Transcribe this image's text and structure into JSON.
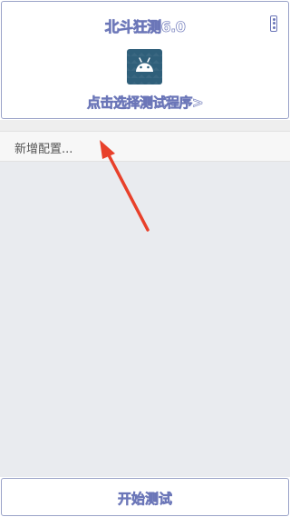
{
  "header": {
    "title": "北斗狂测6.0",
    "select_app_label": "点击选择测试程序>",
    "app_icon": "android-icon",
    "menu_icon": "more-vertical-icon"
  },
  "main": {
    "add_config_label": "新增配置..."
  },
  "footer": {
    "start_test_label": "开始测试"
  },
  "colors": {
    "outline_text": "#6b76b8",
    "panel_border": "#9aa3c8",
    "main_background": "#e9ebef",
    "icon_background": "#2f5f7a",
    "annotation_arrow": "#e8402a"
  }
}
